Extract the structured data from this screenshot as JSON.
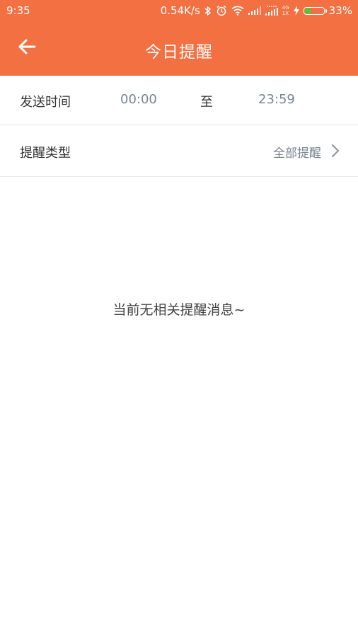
{
  "status_bar": {
    "time": "9:35",
    "network_speed": "0.54K/s",
    "network_type_top": "4G",
    "network_type_bottom": "1X",
    "battery": "33%",
    "battery_level": 0.33,
    "icons": [
      "bluetooth-icon",
      "alarm-icon",
      "wifi-icon",
      "signal-icon",
      "signal-icon",
      "charging-icon",
      "battery-icon"
    ]
  },
  "header": {
    "title": "今日提醒",
    "back_icon": "arrow-left-icon",
    "color": "#f27042"
  },
  "send_time": {
    "label": "发送时间",
    "start": "00:00",
    "separator": "至",
    "end": "23:59"
  },
  "reminder_type": {
    "label": "提醒类型",
    "value": "全部提醒",
    "icon": "chevron-right-icon"
  },
  "empty_state": {
    "message": "当前无相关提醒消息~"
  }
}
